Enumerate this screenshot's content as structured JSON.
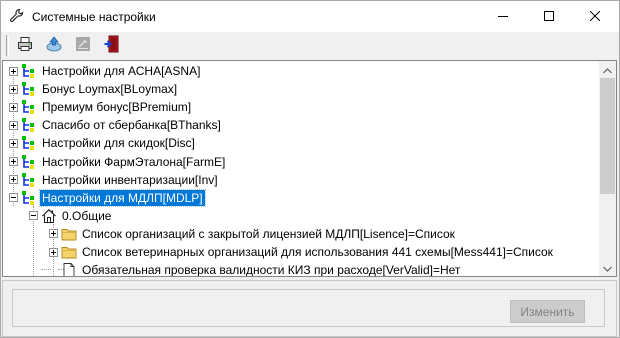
{
  "window": {
    "title": "Системные настройки",
    "icon": "wrench-icon",
    "controls": [
      "minimize-icon",
      "maximize-icon",
      "close-icon"
    ]
  },
  "toolbar": {
    "buttons": [
      {
        "icon": "printer-icon"
      },
      {
        "icon": "refresh-icon"
      },
      {
        "icon": "edit-icon"
      },
      {
        "icon": "exit-door-icon"
      }
    ]
  },
  "tree": {
    "items": [
      {
        "label": "Настройки для АСНА[ASNA]",
        "expander": "plus",
        "icon": "node-green-icon",
        "level": 0,
        "selected": false
      },
      {
        "label": "Бонус Loymax[BLoymax]",
        "expander": "plus",
        "icon": "node-green-icon",
        "level": 0,
        "selected": false
      },
      {
        "label": "Премиум бонус[BPremium]",
        "expander": "plus",
        "icon": "node-green-icon",
        "level": 0,
        "selected": false
      },
      {
        "label": "Спасибо от сбербанка[BThanks]",
        "expander": "plus",
        "icon": "node-green-icon",
        "level": 0,
        "selected": false
      },
      {
        "label": "Настройки для скидок[Disc]",
        "expander": "plus",
        "icon": "node-green-icon",
        "level": 0,
        "selected": false
      },
      {
        "label": "Настройки ФармЭталона[FarmE]",
        "expander": "plus",
        "icon": "node-green-icon",
        "level": 0,
        "selected": false
      },
      {
        "label": "Настройки инвентаризации[Inv]",
        "expander": "plus",
        "icon": "node-green-icon",
        "level": 0,
        "selected": false
      },
      {
        "label": "Настройки для МДЛП[MDLP]",
        "expander": "minus",
        "icon": "node-green-icon",
        "level": 0,
        "selected": true
      },
      {
        "label": "0.Общие",
        "expander": "minus",
        "icon": "home-icon",
        "level": 1,
        "selected": false
      },
      {
        "label": "Список организаций с закрытой лицензией МДЛП[Lisence]=Список",
        "expander": "plus",
        "icon": "folder-icon",
        "level": 2,
        "selected": false
      },
      {
        "label": "Список ветеринарных организаций для использования 441 схемы[Mess441]=Список",
        "expander": "plus",
        "icon": "folder-icon",
        "level": 2,
        "selected": false
      },
      {
        "label": "Обязательная проверка валидности КИЗ при расходе[VerValid]=Нет",
        "expander": "none",
        "icon": "document-icon",
        "level": 2,
        "selected": false
      }
    ]
  },
  "bottom": {
    "edit_button_label": "Изменить"
  },
  "colors": {
    "selection": "#0078d7",
    "node_green": "#00c000",
    "node_blue": "#1030e0",
    "node_yellow": "#e8e000",
    "folder": "#f5d36b"
  }
}
